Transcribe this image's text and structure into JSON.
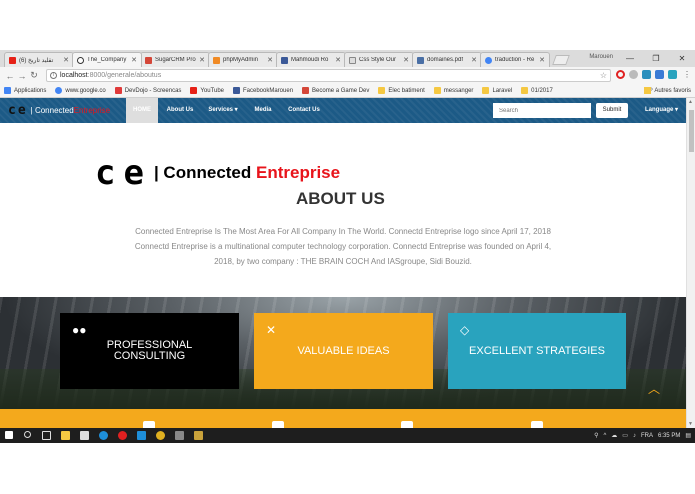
{
  "browser": {
    "tabs": [
      {
        "label": "(6) تقلید تاریخ",
        "color": "#e62117",
        "active": false
      },
      {
        "label": "The_Company",
        "color": "#333333",
        "active": true
      },
      {
        "label": "SugarCRM Pro",
        "color": "#d44638",
        "active": false
      },
      {
        "label": "phpMyAdmin",
        "color": "#f08a24",
        "active": false
      },
      {
        "label": "Mahmoudi Ro",
        "color": "#3b5998",
        "active": false
      },
      {
        "label": "Css Style Our",
        "color": "#888888",
        "active": false
      },
      {
        "label": "domaines.pdf",
        "color": "#4a6fa5",
        "active": false
      },
      {
        "label": "traduction - Re",
        "color": "#4285f4",
        "active": false
      }
    ],
    "profile": "Marouen",
    "url_host": "localhost",
    "url_path": ":8000/generale/aboutus",
    "bookmarks": [
      {
        "label": "Applications",
        "color": "#4285f4"
      },
      {
        "label": "www.google.co",
        "color": "#4285f4"
      },
      {
        "label": "DevDojo - Screencas",
        "color": "#e03a3a"
      },
      {
        "label": "YouTube",
        "color": "#e62117"
      },
      {
        "label": "FacebookMarouen",
        "color": "#3b5998"
      },
      {
        "label": "Become a Game Dev",
        "color": "#d44638"
      },
      {
        "label": "Elec batiment",
        "color": "#f5c842"
      },
      {
        "label": "messanger",
        "color": "#f5c842"
      },
      {
        "label": "Laravel",
        "color": "#f5c842"
      },
      {
        "label": "01/2017",
        "color": "#f5c842"
      }
    ],
    "bookmarks_more": "»",
    "other_bookmarks": "Autres favoris"
  },
  "site": {
    "brand_ce": "ce",
    "brand_prefix": "| Connected ",
    "brand_red": "Entreprise",
    "nav": {
      "home": "HOME",
      "about": "About Us",
      "services": "Services ▾",
      "media": "Media",
      "contact": "Contact Us",
      "language": "Language ▾"
    },
    "search_placeholder": "Search",
    "submit_label": "Submit"
  },
  "content": {
    "logo_ce": "ce",
    "logo_prefix": "| Connected ",
    "logo_red": "Entreprise",
    "title": "ABOUT US",
    "paragraph": "Connected Entreprise Is The Most Area For All Company In The World. Connectd Entreprise logo since April 17, 2018 Connectd Entreprise is a multinational computer technology corporation. Connectd Entreprise was founded on April 4, 2018, by two company : THE BRAIN COCH And IASgroupe, Sidi Bouzid.",
    "cards": [
      {
        "label": "PROFESSIONAL CONSULTING",
        "icon": "users-icon"
      },
      {
        "label": "VALUABLE IDEAS",
        "icon": "expand-arrows-icon"
      },
      {
        "label": "EXCELLENT STRATEGIES",
        "icon": "diamond-icon"
      }
    ]
  },
  "taskbar": {
    "language": "FRA",
    "time": "6:35 PM"
  }
}
